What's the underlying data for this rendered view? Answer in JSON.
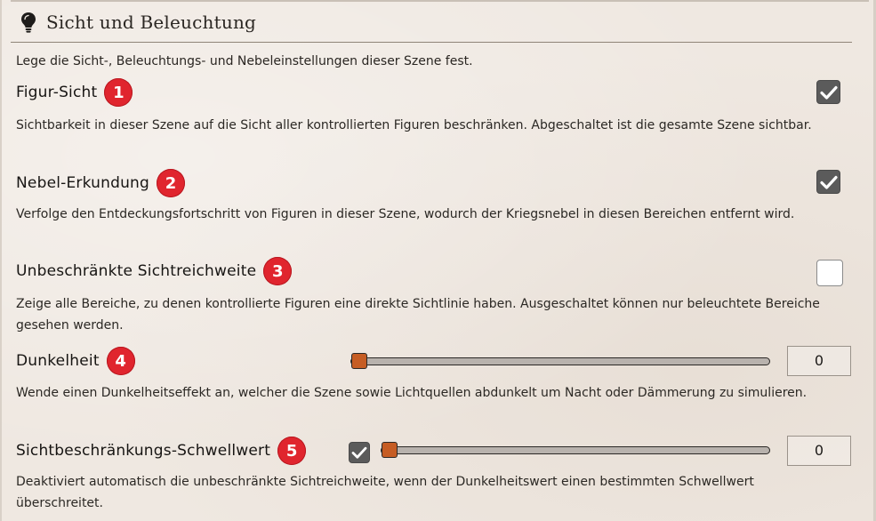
{
  "header": {
    "title": "Sicht und Beleuchtung",
    "icon": "lightbulb-icon"
  },
  "intro": "Lege die Sicht-, Beleuchtungs- und Nebeleinstellungen dieser Szene fest.",
  "colors": {
    "badge": "#e0252e",
    "checkbox_checked": "#5b5b5b",
    "slider_thumb": "#c65d24"
  },
  "settings": [
    {
      "label": "Figur-Sicht",
      "badge": "1",
      "checked": true,
      "description": "Sichtbarkeit in dieser Szene auf die Sicht aller kontrollierten Figuren beschränken. Abgeschaltet ist die gesamte Szene sichtbar."
    },
    {
      "label": "Nebel-Erkundung",
      "badge": "2",
      "checked": true,
      "description": "Verfolge den Entdeckungsfortschritt von Figuren in dieser Szene, wodurch der Kriegsnebel in diesen Bereichen entfernt wird."
    },
    {
      "label": "Unbeschränkte Sichtreichweite",
      "badge": "3",
      "checked": false,
      "description": "Zeige alle Bereiche, zu denen kontrollierte Figuren eine direkte Sichtlinie haben. Ausgeschaltet können nur beleuchtete Bereiche gesehen werden."
    },
    {
      "label": "Dunkelheit",
      "badge": "4",
      "slider_value": 0,
      "value": "0",
      "description": "Wende einen Dunkelheitseffekt an, welcher die Szene sowie Lichtquellen abdunkelt um Nacht oder Dämmerung zu simulieren."
    },
    {
      "label": "Sichtbeschränkungs-Schwellwert",
      "badge": "5",
      "checked": true,
      "slider_value": 0,
      "value": "0",
      "description": "Deaktiviert automatisch die unbeschränkte Sichtreichweite, wenn der Dunkelheitswert einen bestimmten Schwellwert überschreitet."
    }
  ]
}
